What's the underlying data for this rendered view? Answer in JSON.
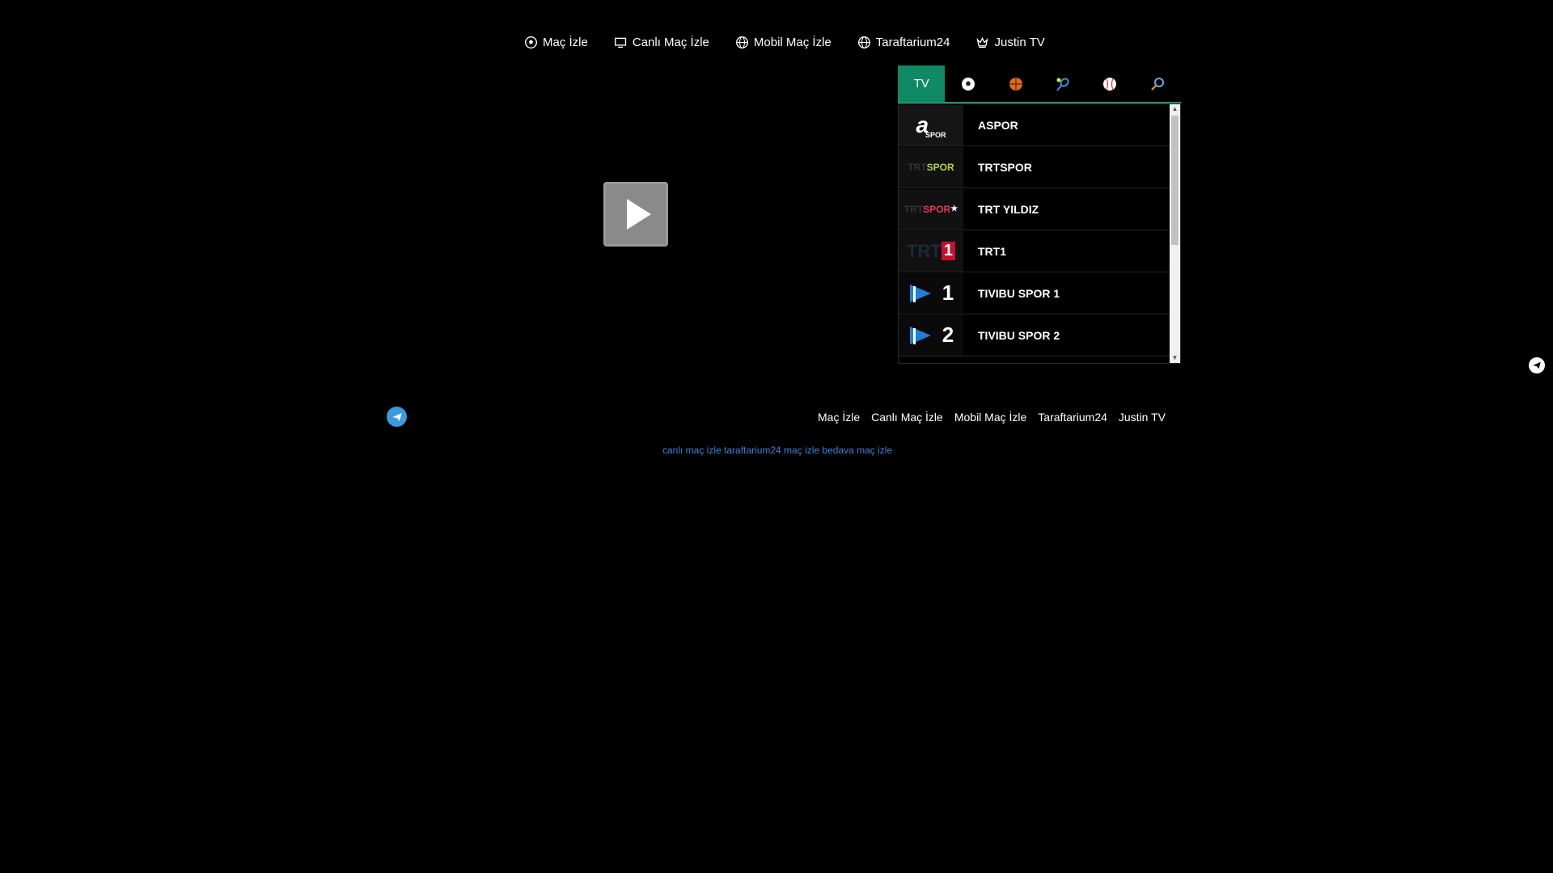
{
  "nav": [
    {
      "label": "Maç İzle",
      "icon": "soccer-ball-icon"
    },
    {
      "label": "Canlı Maç İzle",
      "icon": "tv-icon"
    },
    {
      "label": "Mobil Maç İzle",
      "icon": "globe-icon"
    },
    {
      "label": "Taraftarium24",
      "icon": "globe-icon"
    },
    {
      "label": "Justin TV",
      "icon": "crown-icon"
    }
  ],
  "tabs": [
    {
      "label": "TV",
      "icon": "tv-tab"
    },
    {
      "label": "",
      "icon": "soccer-icon"
    },
    {
      "label": "",
      "icon": "basketball-icon"
    },
    {
      "label": "",
      "icon": "tennis-icon"
    },
    {
      "label": "",
      "icon": "baseball-icon"
    },
    {
      "label": "",
      "icon": "search-icon"
    }
  ],
  "channels": [
    {
      "name": "ASPOR",
      "logo": "a spor"
    },
    {
      "name": "TRTSPOR",
      "logo": "TRT SPOR"
    },
    {
      "name": "TRT YILDIZ",
      "logo": "TRT SPOR★"
    },
    {
      "name": "TRT1",
      "logo": "TRT 1"
    },
    {
      "name": "TIVIBU SPOR 1",
      "logo": "1"
    },
    {
      "name": "TIVIBU SPOR 2",
      "logo": "2"
    }
  ],
  "footer_links": [
    "Maç İzle",
    "Canlı Maç İzle",
    "Mobil Maç İzle",
    "Taraftarium24",
    "Justin TV"
  ],
  "seo_text": "canlı maç izle taraftarium24 maç izle bedava maç izle",
  "colors": {
    "accent": "#0f8a64",
    "link": "#3c82d6",
    "telegram": "#3a9be0"
  }
}
